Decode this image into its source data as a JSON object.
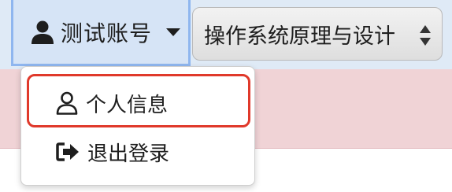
{
  "account": {
    "label": "测试账号",
    "icon": "user-icon",
    "caret_icon": "caret-down-icon"
  },
  "course_select": {
    "selected": "操作系统原理与设计",
    "icon": "select-arrows-icon"
  },
  "dropdown": {
    "items": [
      {
        "label": "个人信息",
        "icon": "user-outline-icon"
      },
      {
        "label": "退出登录",
        "icon": "sign-out-icon"
      }
    ]
  },
  "colors": {
    "topbar": "#dfeaf6",
    "alert_strip": "#f0d3d6",
    "highlight": "#e0392b",
    "active_border": "#8fb6ef"
  }
}
